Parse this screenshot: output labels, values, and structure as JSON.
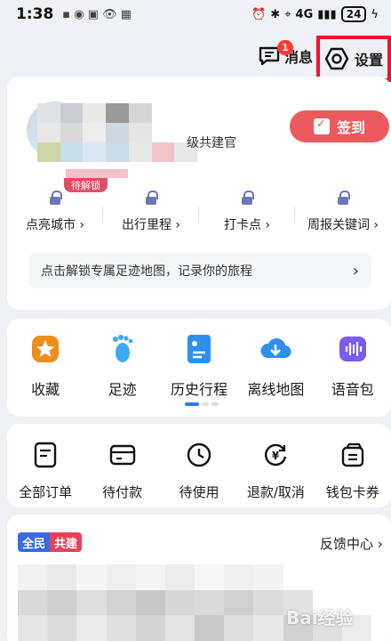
{
  "status_bar": {
    "time": "1:38",
    "network": "4G",
    "battery": "24"
  },
  "top_bar": {
    "messages_label": "消息",
    "messages_badge": "1",
    "settings_label": "设置"
  },
  "profile": {
    "level_text": "级共建官",
    "unlock_tag": "待解锁",
    "signin_label": "签到",
    "stats": [
      {
        "label": "点亮城市 ›"
      },
      {
        "label": "出行里程 ›"
      },
      {
        "label": "打卡点 ›"
      },
      {
        "label": "周报关键词 ›"
      }
    ],
    "unlock_bar_text": "点击解锁专属足迹地图，记录你的旅程",
    "unlock_bar_arrow": "›"
  },
  "tools": [
    {
      "label": "收藏",
      "icon": "star-icon"
    },
    {
      "label": "足迹",
      "icon": "footprint-icon"
    },
    {
      "label": "历史行程",
      "icon": "history-trip-icon"
    },
    {
      "label": "离线地图",
      "icon": "offline-map-download-icon"
    },
    {
      "label": "语音包",
      "icon": "voice-pack-icon"
    }
  ],
  "orders": [
    {
      "label": "全部订单",
      "icon": "all-orders-icon"
    },
    {
      "label": "待付款",
      "icon": "wallet-card-icon"
    },
    {
      "label": "待使用",
      "icon": "clock-icon"
    },
    {
      "label": "退款/取消",
      "icon": "refund-yen-icon"
    },
    {
      "label": "钱包卡券",
      "icon": "wallet-coupon-icon"
    }
  ],
  "feedback": {
    "tag_part1": "全民",
    "tag_part2": "共建",
    "center_label": "反馈中心 ›"
  },
  "watermark": "Bai经验",
  "colors": {
    "accent_red": "#ec5a5d",
    "highlight_box": "#e8172b",
    "lock_blue": "#6b79b8",
    "page_dot_active": "#3478f6"
  }
}
